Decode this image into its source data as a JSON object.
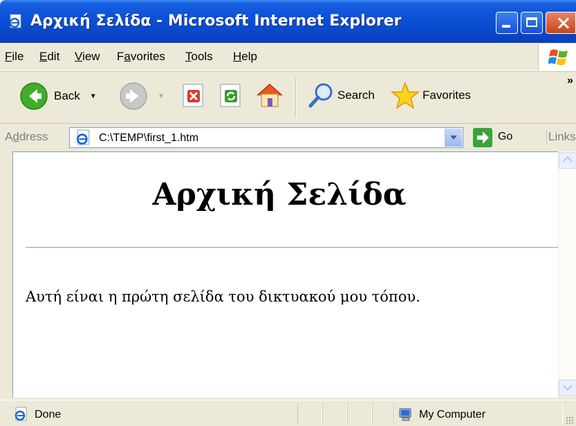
{
  "window": {
    "title": "Αρχική Σελίδα - Microsoft Internet Explorer",
    "buttons": {
      "minimize": "minimize",
      "maximize": "maximize",
      "close": "close"
    }
  },
  "menu": [
    {
      "label": "File",
      "accel": "F",
      "rest": "ile"
    },
    {
      "label": "Edit",
      "accel": "E",
      "rest": "dit"
    },
    {
      "label": "View",
      "accel": "V",
      "rest": "iew"
    },
    {
      "label": "Favorites",
      "pre": "F",
      "accel": "a",
      "rest": "vorites"
    },
    {
      "label": "Tools",
      "accel": "T",
      "rest": "ools"
    },
    {
      "label": "Help",
      "accel": "H",
      "rest": "elp"
    }
  ],
  "toolbar": {
    "back_label": "Back",
    "search_label": "Search",
    "favorites_label": "Favorites",
    "overflow": "»"
  },
  "address": {
    "label_pre": "A",
    "label_accel": "d",
    "label_rest": "dress",
    "url": "C:\\TEMP\\first_1.htm",
    "go_label": "Go",
    "links_label": "Links"
  },
  "page": {
    "heading": "Αρχική Σελίδα",
    "paragraph": "Αυτή είναι η πρώτη σελίδα του δικτυακού μου τόπου."
  },
  "status": {
    "text": "Done",
    "zone": "My Computer"
  },
  "colors": {
    "titlebar": "#0A48C9",
    "chrome": "#ECE9D8",
    "close_button": "#C6441E",
    "go_button": "#3BA33B"
  },
  "icons": {
    "title": "ie-page-icon",
    "back": "back-arrow-icon",
    "forward": "forward-arrow-icon",
    "stop": "stop-icon",
    "refresh": "refresh-icon",
    "home": "home-icon",
    "search": "magnifier-icon",
    "favorites": "star-icon",
    "address": "ie-page-icon",
    "go": "go-arrow-icon",
    "status": "ie-page-icon",
    "zone": "my-computer-icon"
  }
}
